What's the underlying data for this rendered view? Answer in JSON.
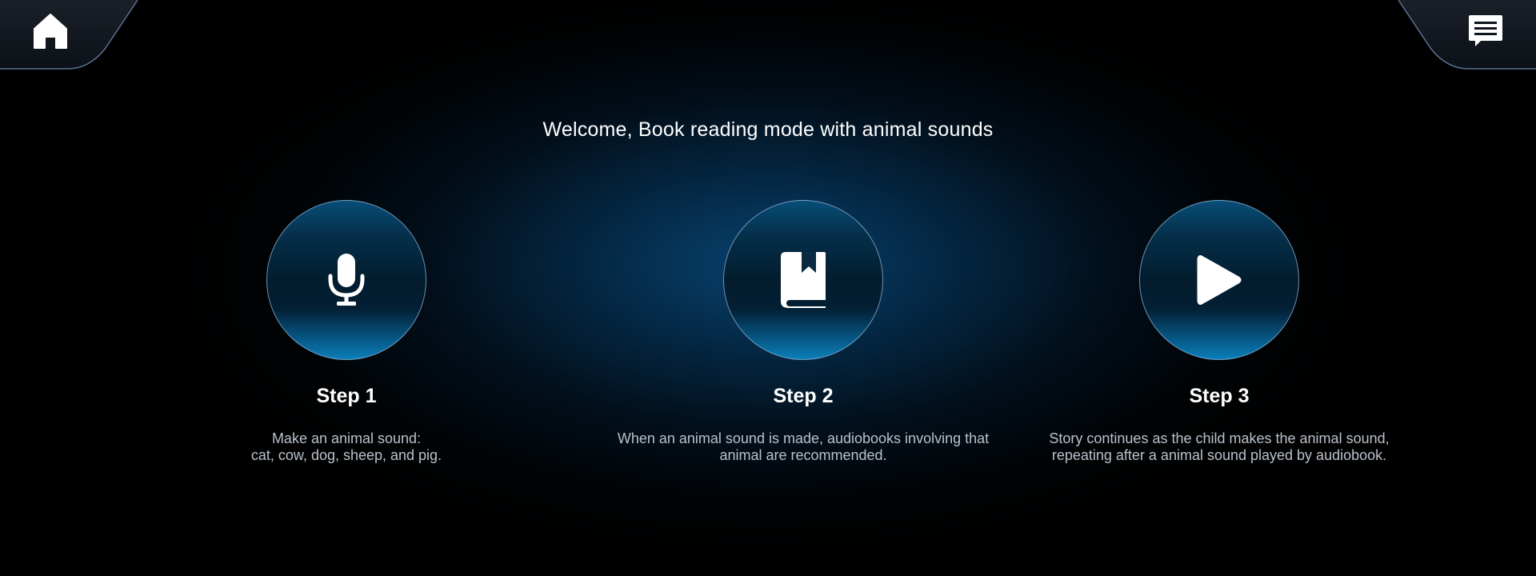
{
  "header": {
    "home_icon": "home-icon",
    "messages_icon": "message-icon"
  },
  "title": "Welcome, Book reading mode with animal sounds",
  "steps": [
    {
      "icon": "microphone-icon",
      "label": "Step 1",
      "description_lines": [
        "Make an animal sound:",
        "cat, cow, dog, sheep, and pig."
      ]
    },
    {
      "icon": "book-icon",
      "label": "Step 2",
      "description_lines": [
        "When an animal sound is made, audiobooks involving that",
        "animal are recommended."
      ]
    },
    {
      "icon": "play-icon",
      "label": "Step 3",
      "description_lines": [
        "Story continues as the child makes the animal sound,",
        "repeating after a animal sound played by audiobook."
      ]
    }
  ],
  "colors": {
    "accent": "#0b7fb8",
    "background": "#000000",
    "text_primary": "#ffffff",
    "text_secondary": "#b9c2cc"
  }
}
